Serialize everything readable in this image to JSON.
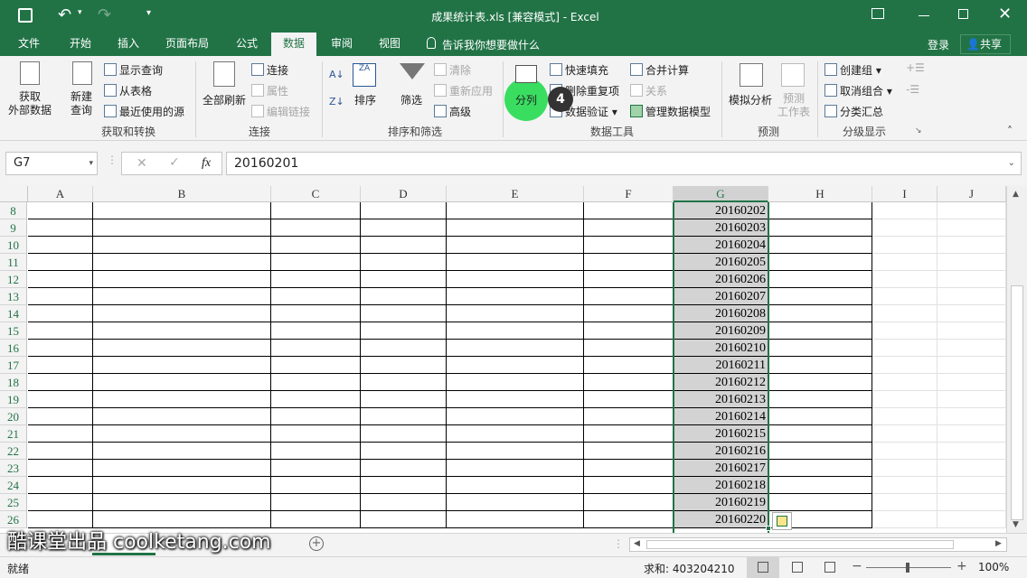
{
  "window": {
    "title": "成果统计表.xls  [兼容模式] - Excel",
    "controls": [
      "restore",
      "minimize",
      "maximize",
      "close"
    ]
  },
  "tabs": [
    "文件",
    "开始",
    "插入",
    "页面布局",
    "公式",
    "数据",
    "审阅",
    "视图"
  ],
  "active_tab": "数据",
  "tell_me": "告诉我你想要做什么",
  "login": "登录",
  "share": "共享",
  "ribbon": {
    "get_external": "获取\n外部数据",
    "new_query": "新建\n查询",
    "show_query": "显示查询",
    "from_table": "从表格",
    "recent_sources": "最近使用的源",
    "group_get": "获取和转换",
    "refresh_all": "全部刷新",
    "connections": "连接",
    "properties": "属性",
    "edit_links": "编辑链接",
    "group_conn": "连接",
    "sort": "排序",
    "filter": "筛选",
    "clear": "清除",
    "reapply": "重新应用",
    "advanced": "高级",
    "group_sort": "排序和筛选",
    "text_to_columns": "分列",
    "flash_fill": "快速填充",
    "remove_dup": "删除重复项",
    "data_validation": "数据验证",
    "consolidate": "合并计算",
    "relationships": "关系",
    "data_model": "管理数据模型",
    "group_tools": "数据工具",
    "what_if": "模拟分析",
    "forecast": "预测\n工作表",
    "group_forecast": "预测",
    "group_create": "创建组",
    "ungroup": "取消组合",
    "subtotal": "分类汇总",
    "group_outline": "分级显示",
    "step_badge": "4"
  },
  "formula_bar": {
    "name_box": "G7",
    "fx": "fx",
    "value": "20160201"
  },
  "columns": [
    "A",
    "B",
    "C",
    "D",
    "E",
    "F",
    "G",
    "H",
    "I",
    "J"
  ],
  "selected_column": "G",
  "rows": [
    {
      "num": "8",
      "g": "20160202"
    },
    {
      "num": "9",
      "g": "20160203"
    },
    {
      "num": "10",
      "g": "20160204"
    },
    {
      "num": "11",
      "g": "20160205"
    },
    {
      "num": "12",
      "g": "20160206"
    },
    {
      "num": "13",
      "g": "20160207"
    },
    {
      "num": "14",
      "g": "20160208"
    },
    {
      "num": "15",
      "g": "20160209"
    },
    {
      "num": "16",
      "g": "20160210"
    },
    {
      "num": "17",
      "g": "20160211"
    },
    {
      "num": "18",
      "g": "20160212"
    },
    {
      "num": "19",
      "g": "20160213"
    },
    {
      "num": "20",
      "g": "20160214"
    },
    {
      "num": "21",
      "g": "20160215"
    },
    {
      "num": "22",
      "g": "20160216"
    },
    {
      "num": "23",
      "g": "20160217"
    },
    {
      "num": "24",
      "g": "20160218"
    },
    {
      "num": "25",
      "g": "20160219"
    },
    {
      "num": "26",
      "g": "20160220"
    }
  ],
  "watermark": "酷课堂出品 coolketang.com",
  "status": {
    "ready": "就绪",
    "sum": "求和: 403204210",
    "zoom": "100%"
  }
}
